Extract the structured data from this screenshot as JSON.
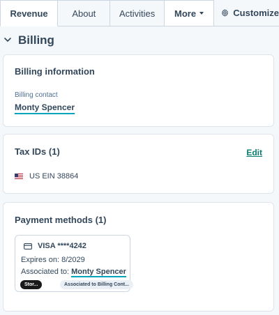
{
  "tabs": {
    "revenue": "Revenue",
    "about": "About",
    "activities": "Activities",
    "more": "More",
    "customize": "Customize"
  },
  "section": {
    "title": "Billing"
  },
  "billing_info": {
    "title": "Billing information",
    "contact_label": "Billing contact",
    "contact_name": "Monty Spencer"
  },
  "tax_ids": {
    "title": "Tax IDs (1)",
    "edit": "Edit",
    "items": [
      {
        "flag_icon": "us-flag-icon",
        "value": "US EIN 38864"
      }
    ]
  },
  "payment_methods": {
    "title": "Payment methods (1)",
    "cards": [
      {
        "icon": "credit-card-icon",
        "card_label": "VISA ****4242",
        "expires": "Expires on: 8/2029",
        "assoc_label": "Associated to:",
        "assoc_name": "Monty Spencer",
        "tag_primary": "Stor...",
        "tag_secondary": "Associated to Billing Cont..."
      }
    ]
  },
  "colors": {
    "accent": "#00a4bd",
    "link": "#0a7d6f",
    "text": "#33475b",
    "border": "#cbd6e2"
  }
}
